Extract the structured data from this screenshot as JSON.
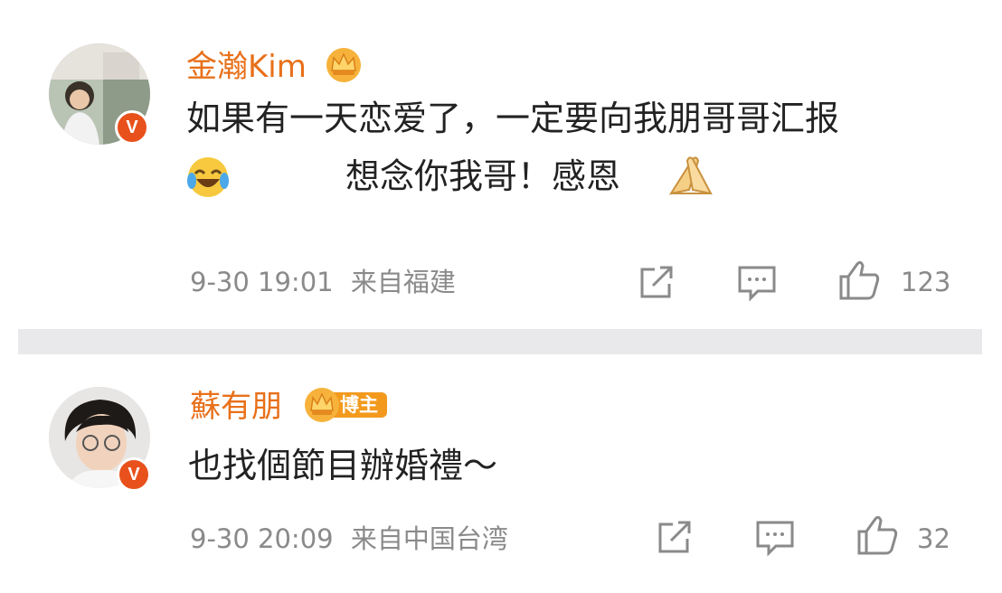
{
  "posts": [
    {
      "username": "金瀚Kim",
      "verified_mark": "V",
      "badge_icon": "crown-icon",
      "content_line1": "如果有一天恋爱了，一定要向我朋哥哥汇报",
      "content_line2_prefix_emoji": "laugh-cry-emoji",
      "content_line2": "想念你我哥！感恩",
      "content_line2_suffix_emoji": "praying-hands-emoji",
      "time": "9-30 19:01",
      "source": "来自福建",
      "likes": "123"
    },
    {
      "username": "蘇有朋",
      "verified_mark": "V",
      "badge_icon": "crown-icon",
      "badge_label": "博主",
      "content_line1": "也找個節目辦婚禮～",
      "time": "9-30 20:09",
      "source": "来自中国台湾",
      "likes": "32"
    }
  ],
  "colors": {
    "username": "#e8701a",
    "verified": "#e8511b",
    "meta": "#8a8a8a",
    "divider": "#e9e9ec"
  }
}
